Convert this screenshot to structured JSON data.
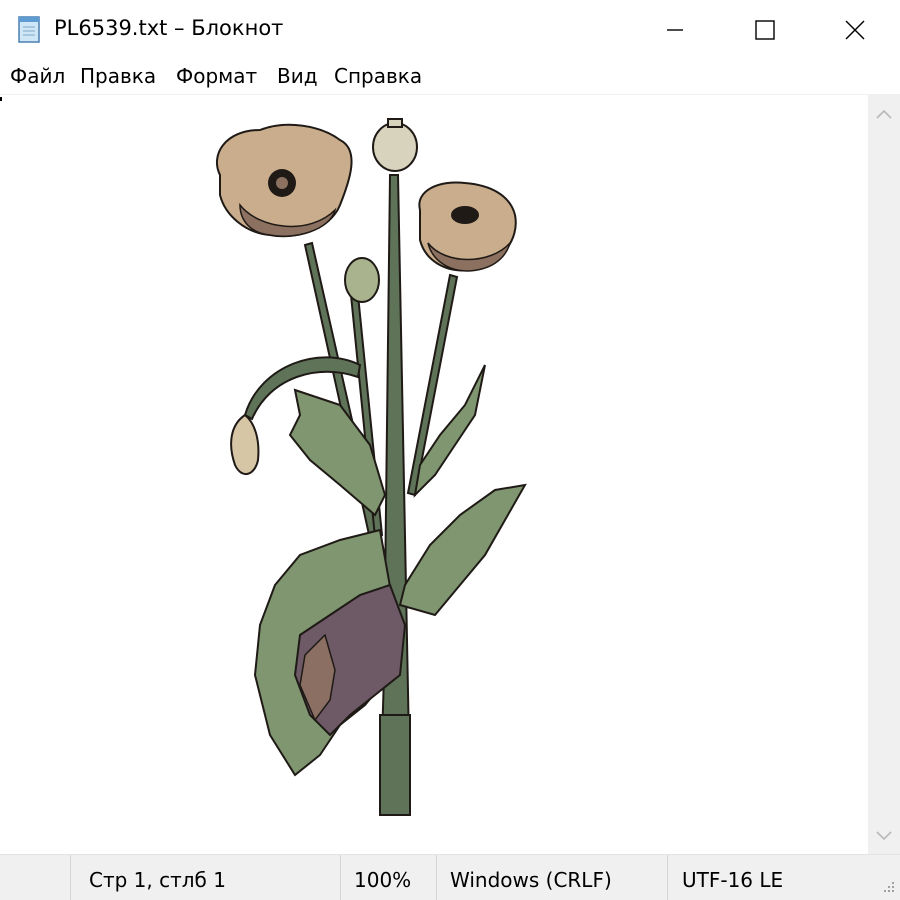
{
  "window": {
    "title": "PL6539.txt – Блокнот",
    "icon": "notepad-icon",
    "buttons": [
      "minimize-icon",
      "maximize-icon",
      "close-icon"
    ]
  },
  "menu": {
    "items": [
      {
        "label": "Файл"
      },
      {
        "label": "Правка"
      },
      {
        "label": "Формат"
      },
      {
        "label": "Вид"
      },
      {
        "label": "Справка"
      }
    ]
  },
  "editor": {
    "content": "ascii-art illustration of poppy flowers"
  },
  "status": {
    "position": "Стр 1, стлб 1",
    "zoom": "100%",
    "line_ending": "Windows (CRLF)",
    "encoding": "UTF-16 LE"
  },
  "colors": {
    "stem": "#5f7358",
    "leaf": "#7f9670",
    "petal": "#c9ad8c",
    "petal_dark": "#8c7060",
    "outline": "#1f1a16",
    "status_bg": "#f0f0f0"
  }
}
